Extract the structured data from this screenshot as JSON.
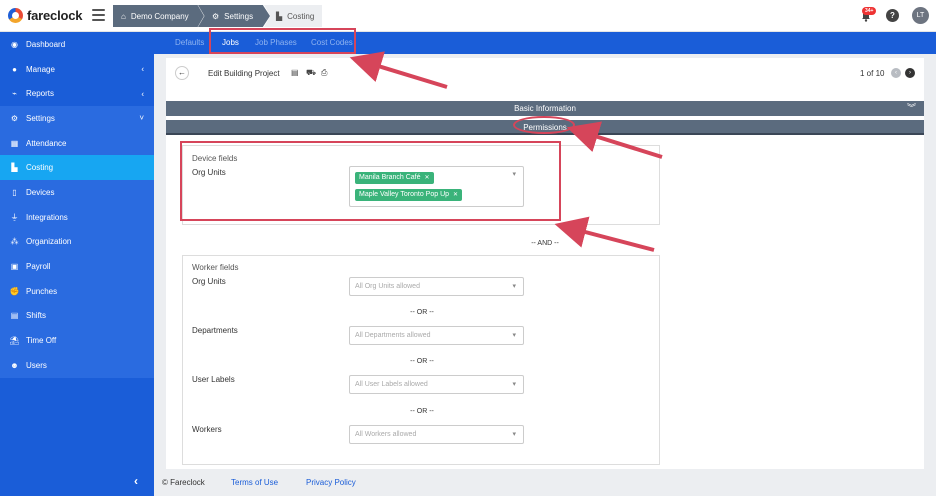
{
  "brand": {
    "name": "fareclock"
  },
  "breadcrumbs": [
    "Demo Company",
    "Settings",
    "Costing"
  ],
  "notifications": {
    "count": "34+"
  },
  "user": {
    "initials": "LT"
  },
  "sidebar": {
    "items": [
      {
        "label": "Dashboard",
        "icon": "dashboard-icon"
      },
      {
        "label": "Manage",
        "icon": "person-icon",
        "chevron": "‹"
      },
      {
        "label": "Reports",
        "icon": "chart-icon",
        "chevron": "‹"
      },
      {
        "label": "Settings",
        "icon": "gear-icon",
        "chevron": "˅"
      },
      {
        "label": "Attendance",
        "icon": "attendance-icon"
      },
      {
        "label": "Costing",
        "icon": "costing-icon"
      },
      {
        "label": "Devices",
        "icon": "device-icon"
      },
      {
        "label": "Integrations",
        "icon": "plug-icon"
      },
      {
        "label": "Organization",
        "icon": "org-icon"
      },
      {
        "label": "Payroll",
        "icon": "payroll-icon"
      },
      {
        "label": "Punches",
        "icon": "punch-icon"
      },
      {
        "label": "Shifts",
        "icon": "shift-icon"
      },
      {
        "label": "Time Off",
        "icon": "beach-icon"
      },
      {
        "label": "Users",
        "icon": "users-icon"
      }
    ],
    "collapse": "‹"
  },
  "tabs": [
    "Defaults",
    "Jobs",
    "Job Phases",
    "Cost Codes"
  ],
  "project": {
    "title": "Edit Building Project",
    "pager": "1 of 10"
  },
  "sections": {
    "basic": "Basic Information",
    "permissions": "Permissions"
  },
  "device_fields": {
    "title": "Device fields",
    "org_units_label": "Org Units",
    "chips": [
      "Manila Branch Café",
      "Maple Valley Toronto Pop Up"
    ]
  },
  "and_sep": "-- AND --",
  "worker_fields": {
    "title": "Worker fields",
    "rows": [
      {
        "label": "Org Units",
        "placeholder": "All Org Units allowed"
      },
      {
        "label": "Departments",
        "placeholder": "All Departments allowed"
      },
      {
        "label": "User Labels",
        "placeholder": "All User Labels allowed"
      },
      {
        "label": "Workers",
        "placeholder": "All Workers allowed"
      }
    ],
    "or_sep": "-- OR --"
  },
  "footer": {
    "copyright": "© Fareclock",
    "terms": "Terms of Use",
    "privacy": "Privacy Policy"
  },
  "colors": {
    "primary": "#1a5dd8",
    "active": "#17a6f2",
    "section": "#5b6b7e",
    "chip": "#3ab37a",
    "annotation": "#d6455a"
  }
}
